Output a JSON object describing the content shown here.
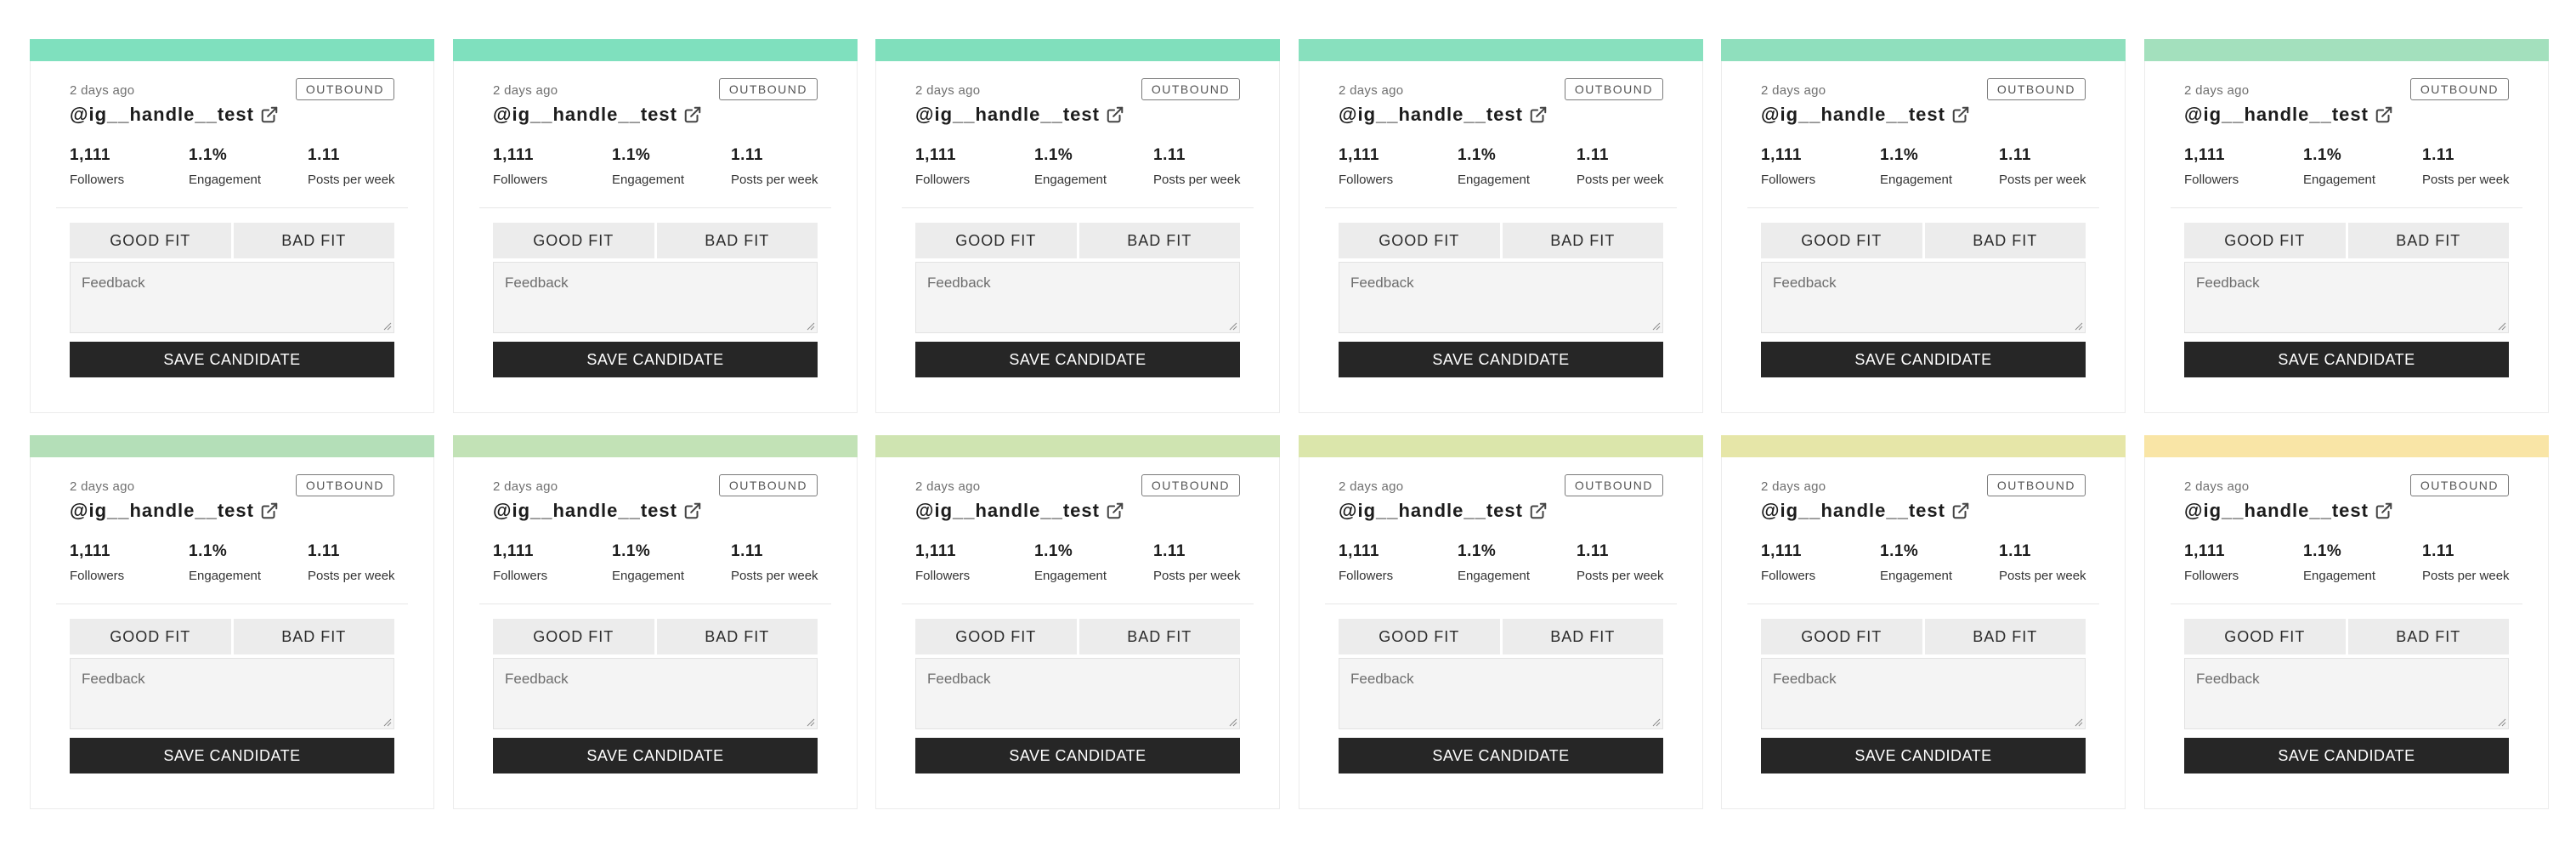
{
  "cards": [
    {
      "color": "#7fe0be",
      "time": "2 days ago",
      "badge": "OUTBOUND",
      "handle": "@ig__handle__test",
      "stats": [
        {
          "value": "1,111",
          "label": "Followers"
        },
        {
          "value": "1.1%",
          "label": "Engagement"
        },
        {
          "value": "1.11",
          "label": "Posts per week"
        }
      ],
      "good_fit": "GOOD FIT",
      "bad_fit": "BAD FIT",
      "feedback_placeholder": "Feedback",
      "save": "SAVE CANDIDATE"
    },
    {
      "color": "#7fe0be",
      "time": "2 days ago",
      "badge": "OUTBOUND",
      "handle": "@ig__handle__test",
      "stats": [
        {
          "value": "1,111",
          "label": "Followers"
        },
        {
          "value": "1.1%",
          "label": "Engagement"
        },
        {
          "value": "1.11",
          "label": "Posts per week"
        }
      ],
      "good_fit": "GOOD FIT",
      "bad_fit": "BAD FIT",
      "feedback_placeholder": "Feedback",
      "save": "SAVE CANDIDATE"
    },
    {
      "color": "#80dfbc",
      "time": "2 days ago",
      "badge": "OUTBOUND",
      "handle": "@ig__handle__test",
      "stats": [
        {
          "value": "1,111",
          "label": "Followers"
        },
        {
          "value": "1.1%",
          "label": "Engagement"
        },
        {
          "value": "1.11",
          "label": "Posts per week"
        }
      ],
      "good_fit": "GOOD FIT",
      "bad_fit": "BAD FIT",
      "feedback_placeholder": "Feedback",
      "save": "SAVE CANDIDATE"
    },
    {
      "color": "#88e0be",
      "time": "2 days ago",
      "badge": "OUTBOUND",
      "handle": "@ig__handle__test",
      "stats": [
        {
          "value": "1,111",
          "label": "Followers"
        },
        {
          "value": "1.1%",
          "label": "Engagement"
        },
        {
          "value": "1.11",
          "label": "Posts per week"
        }
      ],
      "good_fit": "GOOD FIT",
      "bad_fit": "BAD FIT",
      "feedback_placeholder": "Feedback",
      "save": "SAVE CANDIDATE"
    },
    {
      "color": "#8fdfbd",
      "time": "2 days ago",
      "badge": "OUTBOUND",
      "handle": "@ig__handle__test",
      "stats": [
        {
          "value": "1,111",
          "label": "Followers"
        },
        {
          "value": "1.1%",
          "label": "Engagement"
        },
        {
          "value": "1.11",
          "label": "Posts per week"
        }
      ],
      "good_fit": "GOOD FIT",
      "bad_fit": "BAD FIT",
      "feedback_placeholder": "Feedback",
      "save": "SAVE CANDIDATE"
    },
    {
      "color": "#a3e0bd",
      "time": "2 days ago",
      "badge": "OUTBOUND",
      "handle": "@ig__handle__test",
      "stats": [
        {
          "value": "1,111",
          "label": "Followers"
        },
        {
          "value": "1.1%",
          "label": "Engagement"
        },
        {
          "value": "1.11",
          "label": "Posts per week"
        }
      ],
      "good_fit": "GOOD FIT",
      "bad_fit": "BAD FIT",
      "feedback_placeholder": "Feedback",
      "save": "SAVE CANDIDATE"
    },
    {
      "color": "#b4dfb8",
      "time": "2 days ago",
      "badge": "OUTBOUND",
      "handle": "@ig__handle__test",
      "stats": [
        {
          "value": "1,111",
          "label": "Followers"
        },
        {
          "value": "1.1%",
          "label": "Engagement"
        },
        {
          "value": "1.11",
          "label": "Posts per week"
        }
      ],
      "good_fit": "GOOD FIT",
      "bad_fit": "BAD FIT",
      "feedback_placeholder": "Feedback",
      "save": "SAVE CANDIDATE"
    },
    {
      "color": "#c2e2b6",
      "time": "2 days ago",
      "badge": "OUTBOUND",
      "handle": "@ig__handle__test",
      "stats": [
        {
          "value": "1,111",
          "label": "Followers"
        },
        {
          "value": "1.1%",
          "label": "Engagement"
        },
        {
          "value": "1.11",
          "label": "Posts per week"
        }
      ],
      "good_fit": "GOOD FIT",
      "bad_fit": "BAD FIT",
      "feedback_placeholder": "Feedback",
      "save": "SAVE CANDIDATE"
    },
    {
      "color": "#cfe4b1",
      "time": "2 days ago",
      "badge": "OUTBOUND",
      "handle": "@ig__handle__test",
      "stats": [
        {
          "value": "1,111",
          "label": "Followers"
        },
        {
          "value": "1.1%",
          "label": "Engagement"
        },
        {
          "value": "1.11",
          "label": "Posts per week"
        }
      ],
      "good_fit": "GOOD FIT",
      "bad_fit": "BAD FIT",
      "feedback_placeholder": "Feedback",
      "save": "SAVE CANDIDATE"
    },
    {
      "color": "#dbe6ab",
      "time": "2 days ago",
      "badge": "OUTBOUND",
      "handle": "@ig__handle__test",
      "stats": [
        {
          "value": "1,111",
          "label": "Followers"
        },
        {
          "value": "1.1%",
          "label": "Engagement"
        },
        {
          "value": "1.11",
          "label": "Posts per week"
        }
      ],
      "good_fit": "GOOD FIT",
      "bad_fit": "BAD FIT",
      "feedback_placeholder": "Feedback",
      "save": "SAVE CANDIDATE"
    },
    {
      "color": "#e6e6a8",
      "time": "2 days ago",
      "badge": "OUTBOUND",
      "handle": "@ig__handle__test",
      "stats": [
        {
          "value": "1,111",
          "label": "Followers"
        },
        {
          "value": "1.1%",
          "label": "Engagement"
        },
        {
          "value": "1.11",
          "label": "Posts per week"
        }
      ],
      "good_fit": "GOOD FIT",
      "bad_fit": "BAD FIT",
      "feedback_placeholder": "Feedback",
      "save": "SAVE CANDIDATE"
    },
    {
      "color": "#f9e5a6",
      "time": "2 days ago",
      "badge": "OUTBOUND",
      "handle": "@ig__handle__test",
      "stats": [
        {
          "value": "1,111",
          "label": "Followers"
        },
        {
          "value": "1.1%",
          "label": "Engagement"
        },
        {
          "value": "1.11",
          "label": "Posts per week"
        }
      ],
      "good_fit": "GOOD FIT",
      "bad_fit": "BAD FIT",
      "feedback_placeholder": "Feedback",
      "save": "SAVE CANDIDATE"
    }
  ]
}
